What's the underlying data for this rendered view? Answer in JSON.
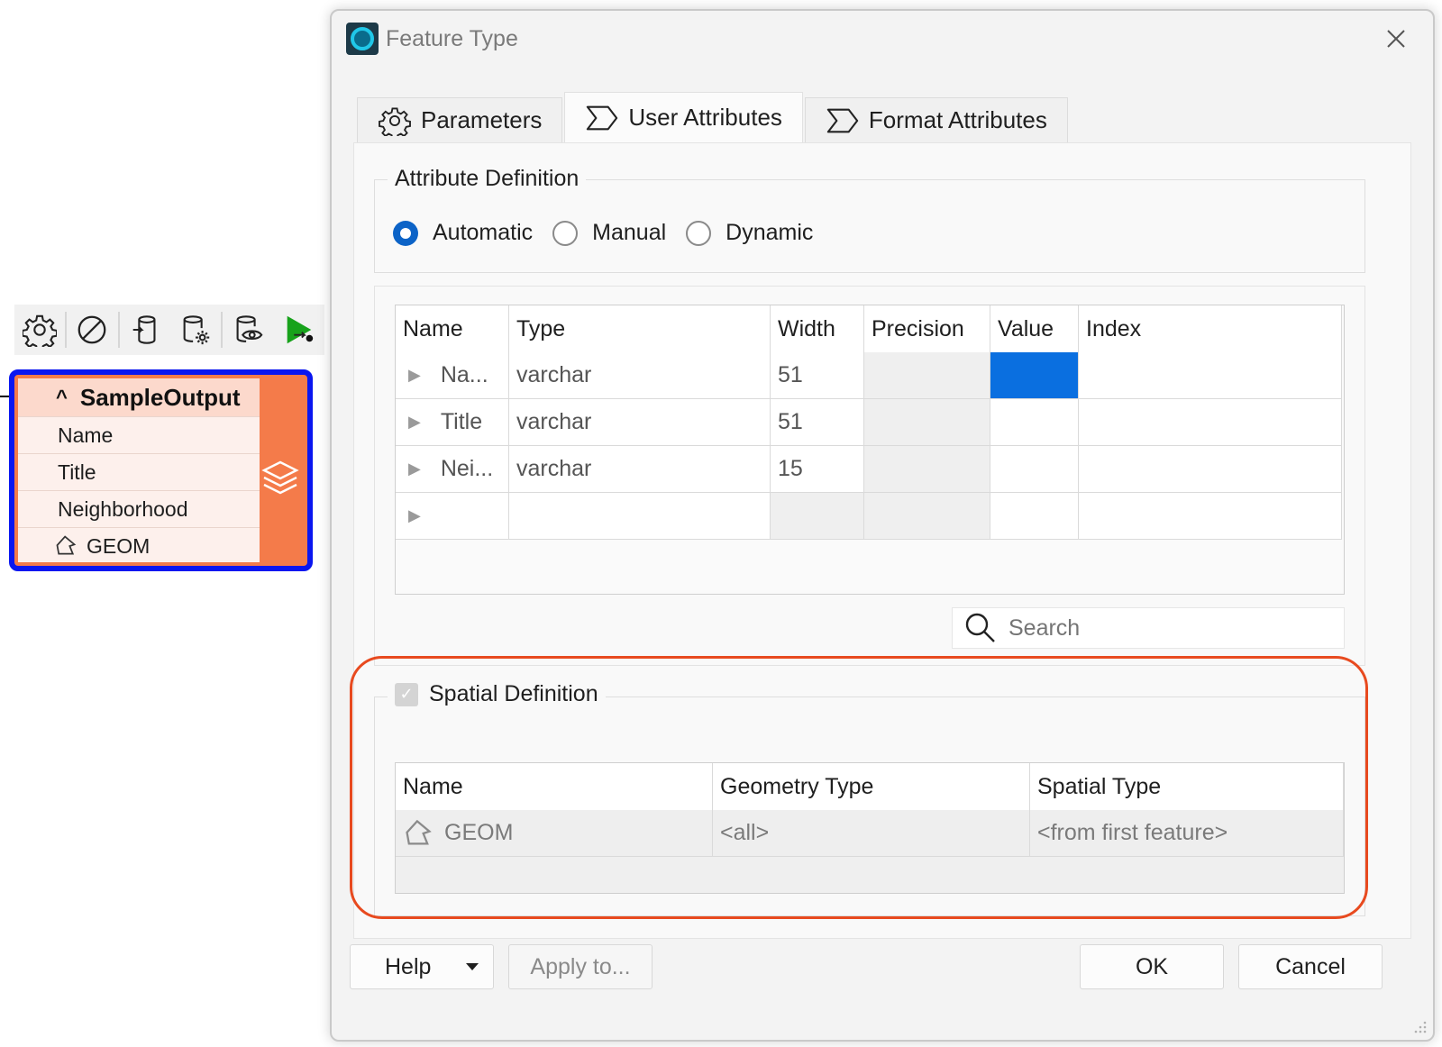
{
  "workspace": {
    "toolbar_icons": [
      "gear-icon",
      "disable-icon",
      "writer-icon",
      "writer-settings-icon",
      "inspect-icon",
      "run-icon"
    ],
    "node": {
      "title": "SampleOutput",
      "attributes": [
        "Name",
        "Title",
        "Neighborhood"
      ],
      "geometry": "GEOM",
      "colors": {
        "accent": "#f47b4a",
        "selection_border": "#0a16f0"
      }
    }
  },
  "dialog": {
    "title": "Feature Type",
    "tabs": [
      {
        "label": "Parameters",
        "icon": "gear-icon"
      },
      {
        "label": "User Attributes",
        "icon": "sigma-tab-icon"
      },
      {
        "label": "Format Attributes",
        "icon": "sigma-tab-icon"
      }
    ],
    "active_tab": "User Attributes",
    "attribute_definition": {
      "title": "Attribute Definition",
      "options": [
        "Automatic",
        "Manual",
        "Dynamic"
      ],
      "selected": "Automatic"
    },
    "attribute_table": {
      "columns": [
        "Name",
        "Type",
        "Width",
        "Precision",
        "Value",
        "Index"
      ],
      "rows": [
        {
          "name": "Na...",
          "type": "varchar",
          "width": "51"
        },
        {
          "name": "Title",
          "type": "varchar",
          "width": "51"
        },
        {
          "name": "Nei...",
          "type": "varchar",
          "width": "15"
        }
      ]
    },
    "search": {
      "placeholder": "Search"
    },
    "spatial_definition": {
      "title": "Spatial Definition",
      "checked": true,
      "columns": [
        "Name",
        "Geometry Type",
        "Spatial Type"
      ],
      "row": {
        "name": "GEOM",
        "geometry_type": "<all>",
        "spatial_type": "<from first feature>"
      }
    },
    "buttons": {
      "help": "Help",
      "apply": "Apply to...",
      "ok": "OK",
      "cancel": "Cancel"
    },
    "colors": {
      "selection": "#0a6fe0",
      "radio_checked": "#0c63c7",
      "highlight": "#e84a1f"
    }
  }
}
